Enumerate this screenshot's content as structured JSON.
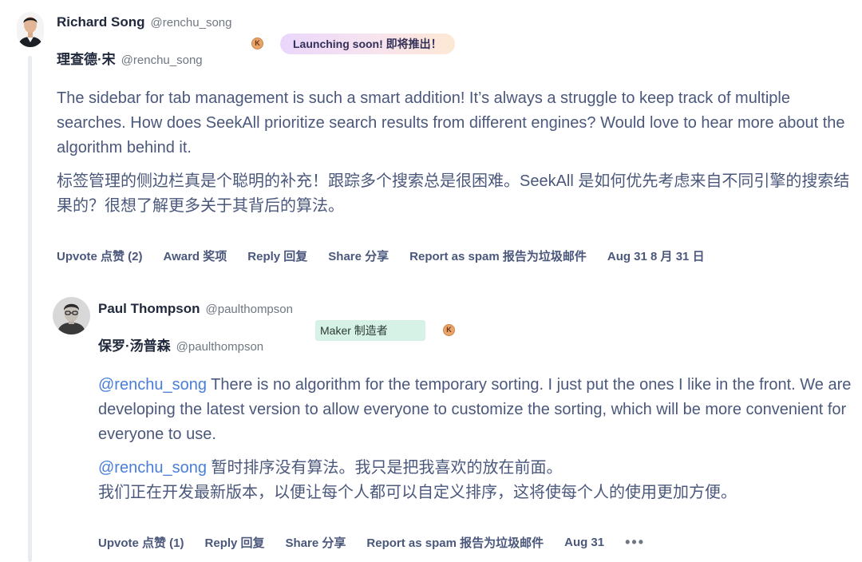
{
  "comment": {
    "name": "Richard Song",
    "handle": "@renchu_song",
    "name_cn": "理查德·宋",
    "handle_cn": "@renchu_song",
    "karma": "K",
    "badge": "Launching soon! 即将推出！",
    "body_en": "The sidebar for tab management is such a smart addition! It’s always a struggle to keep track of multiple searches. How does SeekAll prioritize search results from different engines? Would love to hear more about the algorithm behind it.",
    "body_cn": "标签管理的侧边栏真是个聪明的补充！跟踪多个搜索总是很困难。SeekAll 是如何优先考虑来自不同引擎的搜索结果的？很想了解更多关于其背后的算法。",
    "actions": {
      "upvote": "Upvote 点赞 (2)",
      "award": "Award 奖项",
      "reply": "Reply 回复",
      "share": "Share 分享",
      "report": "Report as spam 报告为垃圾邮件",
      "date": "Aug 31 8 月 31 日"
    }
  },
  "reply": {
    "name": "Paul Thompson",
    "handle": "@paulthompson",
    "name_cn": "保罗·汤普森",
    "handle_cn": "@paulthompson",
    "badge": "Maker 制造者",
    "karma": "K",
    "mention": "@renchu_song",
    "body_en": "There is no algorithm for the temporary sorting. I just put the ones I like in the front. We are developing the latest version to allow everyone to customize the sorting, which will be more convenient for everyone to use.",
    "mention_cn": "@renchu_song",
    "body_cn_1": "暂时排序没有算法。我只是把我喜欢的放在前面。",
    "body_cn_2": "我们正在开发最新版本，以便让每个人都可以自定义排序，这将使每个人的使用更加方便。",
    "actions": {
      "upvote": "Upvote 点赞 (1)",
      "reply": "Reply 回复",
      "share": "Share 分享",
      "report": "Report as spam 报告为垃圾邮件",
      "date": "Aug 31",
      "more": "•••"
    }
  },
  "colors": {
    "body_text": "#4b587c",
    "mention": "#4a7ed9",
    "maker_badge": "#d6f2e7",
    "karma": "#e8a46a"
  }
}
